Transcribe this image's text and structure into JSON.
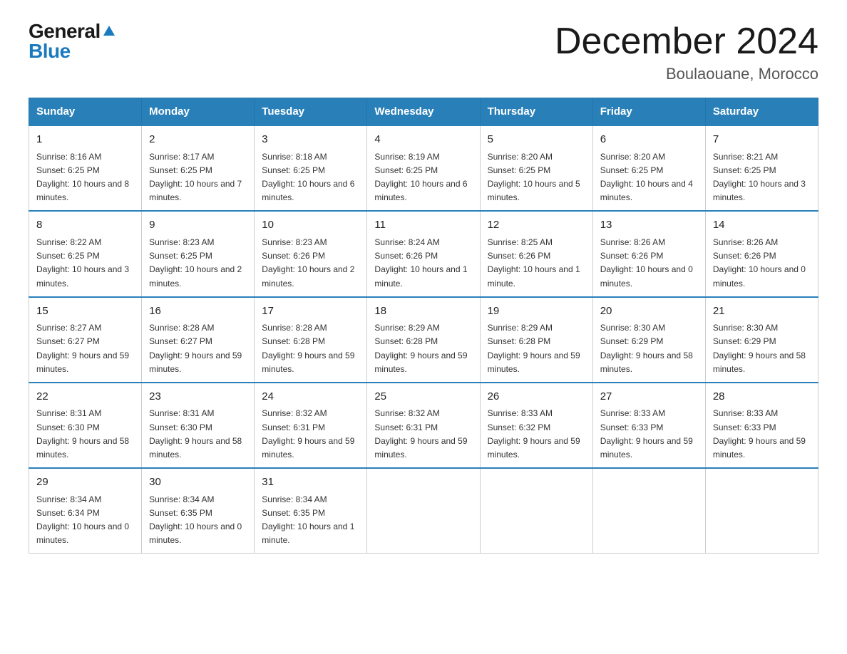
{
  "logo": {
    "general": "General",
    "blue": "Blue"
  },
  "title": {
    "month": "December 2024",
    "location": "Boulaouane, Morocco"
  },
  "headers": [
    "Sunday",
    "Monday",
    "Tuesday",
    "Wednesday",
    "Thursday",
    "Friday",
    "Saturday"
  ],
  "weeks": [
    [
      {
        "day": "1",
        "sunrise": "8:16 AM",
        "sunset": "6:25 PM",
        "daylight": "10 hours and 8 minutes."
      },
      {
        "day": "2",
        "sunrise": "8:17 AM",
        "sunset": "6:25 PM",
        "daylight": "10 hours and 7 minutes."
      },
      {
        "day": "3",
        "sunrise": "8:18 AM",
        "sunset": "6:25 PM",
        "daylight": "10 hours and 6 minutes."
      },
      {
        "day": "4",
        "sunrise": "8:19 AM",
        "sunset": "6:25 PM",
        "daylight": "10 hours and 6 minutes."
      },
      {
        "day": "5",
        "sunrise": "8:20 AM",
        "sunset": "6:25 PM",
        "daylight": "10 hours and 5 minutes."
      },
      {
        "day": "6",
        "sunrise": "8:20 AM",
        "sunset": "6:25 PM",
        "daylight": "10 hours and 4 minutes."
      },
      {
        "day": "7",
        "sunrise": "8:21 AM",
        "sunset": "6:25 PM",
        "daylight": "10 hours and 3 minutes."
      }
    ],
    [
      {
        "day": "8",
        "sunrise": "8:22 AM",
        "sunset": "6:25 PM",
        "daylight": "10 hours and 3 minutes."
      },
      {
        "day": "9",
        "sunrise": "8:23 AM",
        "sunset": "6:25 PM",
        "daylight": "10 hours and 2 minutes."
      },
      {
        "day": "10",
        "sunrise": "8:23 AM",
        "sunset": "6:26 PM",
        "daylight": "10 hours and 2 minutes."
      },
      {
        "day": "11",
        "sunrise": "8:24 AM",
        "sunset": "6:26 PM",
        "daylight": "10 hours and 1 minute."
      },
      {
        "day": "12",
        "sunrise": "8:25 AM",
        "sunset": "6:26 PM",
        "daylight": "10 hours and 1 minute."
      },
      {
        "day": "13",
        "sunrise": "8:26 AM",
        "sunset": "6:26 PM",
        "daylight": "10 hours and 0 minutes."
      },
      {
        "day": "14",
        "sunrise": "8:26 AM",
        "sunset": "6:26 PM",
        "daylight": "10 hours and 0 minutes."
      }
    ],
    [
      {
        "day": "15",
        "sunrise": "8:27 AM",
        "sunset": "6:27 PM",
        "daylight": "9 hours and 59 minutes."
      },
      {
        "day": "16",
        "sunrise": "8:28 AM",
        "sunset": "6:27 PM",
        "daylight": "9 hours and 59 minutes."
      },
      {
        "day": "17",
        "sunrise": "8:28 AM",
        "sunset": "6:28 PM",
        "daylight": "9 hours and 59 minutes."
      },
      {
        "day": "18",
        "sunrise": "8:29 AM",
        "sunset": "6:28 PM",
        "daylight": "9 hours and 59 minutes."
      },
      {
        "day": "19",
        "sunrise": "8:29 AM",
        "sunset": "6:28 PM",
        "daylight": "9 hours and 59 minutes."
      },
      {
        "day": "20",
        "sunrise": "8:30 AM",
        "sunset": "6:29 PM",
        "daylight": "9 hours and 58 minutes."
      },
      {
        "day": "21",
        "sunrise": "8:30 AM",
        "sunset": "6:29 PM",
        "daylight": "9 hours and 58 minutes."
      }
    ],
    [
      {
        "day": "22",
        "sunrise": "8:31 AM",
        "sunset": "6:30 PM",
        "daylight": "9 hours and 58 minutes."
      },
      {
        "day": "23",
        "sunrise": "8:31 AM",
        "sunset": "6:30 PM",
        "daylight": "9 hours and 58 minutes."
      },
      {
        "day": "24",
        "sunrise": "8:32 AM",
        "sunset": "6:31 PM",
        "daylight": "9 hours and 59 minutes."
      },
      {
        "day": "25",
        "sunrise": "8:32 AM",
        "sunset": "6:31 PM",
        "daylight": "9 hours and 59 minutes."
      },
      {
        "day": "26",
        "sunrise": "8:33 AM",
        "sunset": "6:32 PM",
        "daylight": "9 hours and 59 minutes."
      },
      {
        "day": "27",
        "sunrise": "8:33 AM",
        "sunset": "6:33 PM",
        "daylight": "9 hours and 59 minutes."
      },
      {
        "day": "28",
        "sunrise": "8:33 AM",
        "sunset": "6:33 PM",
        "daylight": "9 hours and 59 minutes."
      }
    ],
    [
      {
        "day": "29",
        "sunrise": "8:34 AM",
        "sunset": "6:34 PM",
        "daylight": "10 hours and 0 minutes."
      },
      {
        "day": "30",
        "sunrise": "8:34 AM",
        "sunset": "6:35 PM",
        "daylight": "10 hours and 0 minutes."
      },
      {
        "day": "31",
        "sunrise": "8:34 AM",
        "sunset": "6:35 PM",
        "daylight": "10 hours and 1 minute."
      },
      null,
      null,
      null,
      null
    ]
  ]
}
